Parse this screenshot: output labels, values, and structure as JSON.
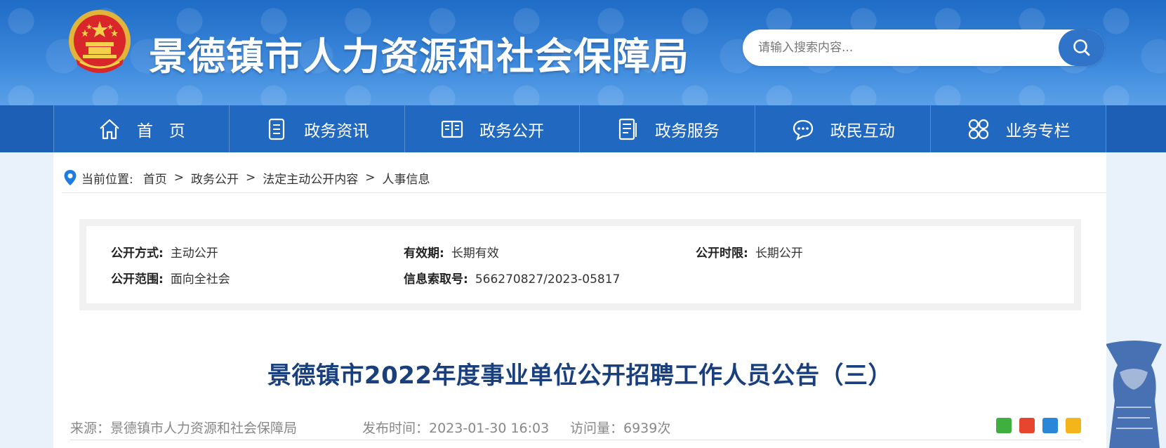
{
  "header": {
    "site_title": "景德镇市人力资源和社会保障局",
    "search": {
      "placeholder": "请输入搜索内容..."
    }
  },
  "nav": {
    "items": [
      {
        "label": "首　页",
        "icon": "home-icon"
      },
      {
        "label": "政务资讯",
        "icon": "document-icon"
      },
      {
        "label": "政务公开",
        "icon": "open-book-icon"
      },
      {
        "label": "政务服务",
        "icon": "list-icon"
      },
      {
        "label": "政民互动",
        "icon": "chat-icon"
      },
      {
        "label": "业务专栏",
        "icon": "grid-icon"
      }
    ]
  },
  "breadcrumb": {
    "prefix": "当前位置:",
    "items": [
      "首页",
      "政务公开",
      "法定主动公开内容",
      "人事信息"
    ],
    "separator": ">"
  },
  "meta": {
    "open_method": {
      "label": "公开方式:",
      "value": "主动公开"
    },
    "validity": {
      "label": "有效期:",
      "value": "长期有效"
    },
    "open_period": {
      "label": "公开时限:",
      "value": "长期公开"
    },
    "open_scope": {
      "label": "公开范围:",
      "value": "面向全社会"
    },
    "index_no": {
      "label": "信息索取号:",
      "value": "566270827/2023-05817"
    }
  },
  "article": {
    "title": "景德镇市2022年度事业单位公开招聘工作人员公告（三）",
    "source": "来源：景德镇市人力资源和社会保障局",
    "published": "发布时间：2023-01-30 16:03",
    "views": "访问量：6939次"
  },
  "share": [
    "wechat-icon",
    "weibo-icon",
    "qq-icon",
    "qzone-icon"
  ],
  "colors": {
    "header_blue": "#1f6cc6",
    "nav_blue": "#2168c0",
    "title_blue": "#1a3f7d"
  }
}
